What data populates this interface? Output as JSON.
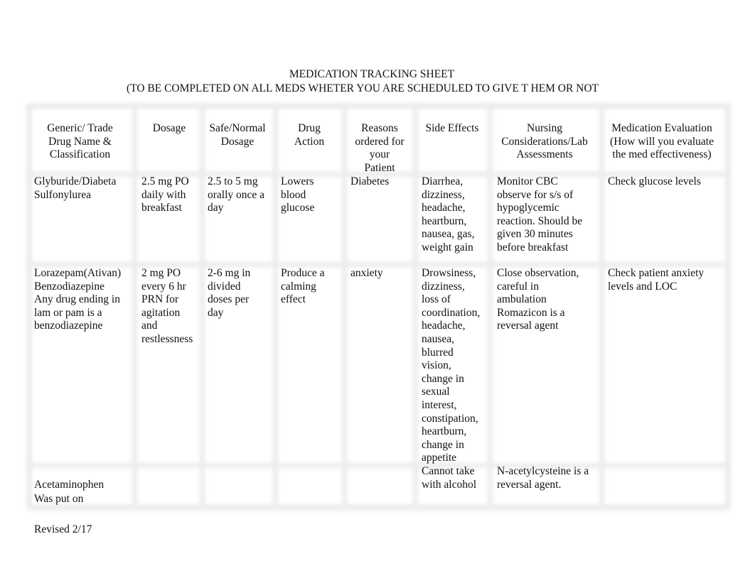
{
  "document": {
    "title": "MEDICATION TRACKING SHEET",
    "subtitle": "(TO BE COMPLETED ON ALL MEDS WHETER YOU ARE SCHEDULED TO GIVE T HEM OR NOT",
    "footer": "Revised 2/17"
  },
  "table": {
    "headers": [
      "Generic/ Trade\nDrug Name &\nClassification",
      "Dosage",
      "Safe/Normal\nDosage",
      "Drug\nAction",
      "Reasons\nordered for\nyour\nPatient",
      "Side Effects",
      "Nursing\nConsiderations/Lab\nAssessments",
      "Medication Evaluation\n(How will you evaluate\nthe med effectiveness)"
    ],
    "rows": [
      {
        "cells": [
          "Glyburide/Diabeta\nSulfonylurea",
          "2.5 mg PO\ndaily with\nbreakfast",
          "2.5 to 5 mg\norally once a\nday",
          "Lowers\nblood\nglucose",
          "Diabetes",
          "Diarrhea,\ndizziness,\nheadache,\nheartburn,\nnausea, gas,\nweight gain",
          "Monitor CBC\nobserve for s/s of\nhypoglycemic\nreaction. Should be\ngiven 30 minutes\nbefore breakfast",
          "Check glucose levels"
        ]
      },
      {
        "cells": [
          "Lorazepam(Ativan)\nBenzodiazepine\nAny drug ending in\nlam or pam is a\nbenzodiazepine",
          "2 mg PO\nevery 6 hr\nPRN for\nagitation\nand\nrestlessness",
          "2-6 mg in\ndivided\ndoses per\nday",
          "Produce a\ncalming\neffect",
          "anxiety",
          "Drowsiness,\ndizziness,\nloss of\ncoordination,\nheadache,\nnausea,\nblurred\nvision,\nchange in\nsexual\ninterest,\nconstipation,\nheartburn,\nchange in\nappetite",
          "Close observation,\ncareful in\nambulation\nRomazicon is a\nreversal agent",
          "Check patient anxiety\nlevels and LOC"
        ]
      },
      {
        "cells": [
          "Acetaminophen\nWas put on",
          "",
          "",
          "",
          "",
          "Cannot take\nwith alcohol",
          "N-acetylcysteine is a\nreversal agent.",
          ""
        ]
      }
    ]
  }
}
